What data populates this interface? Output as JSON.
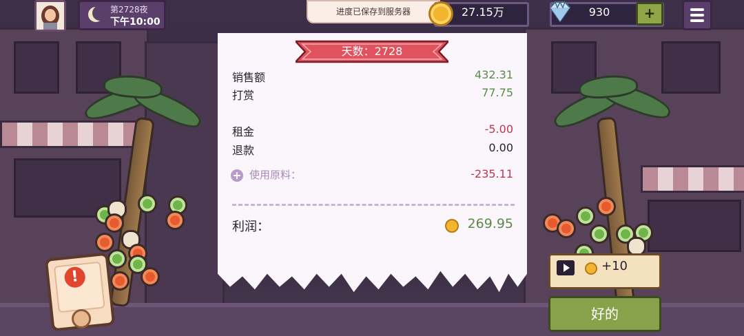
{
  "hud": {
    "night_label": "第2728夜",
    "time_label": "下午10:00",
    "toast": "进度已保存到服务器",
    "coins": "27.15万",
    "gems": "930",
    "add_label": "+"
  },
  "receipt": {
    "day_banner": "天数：2728",
    "rows": [
      {
        "label": "销售额",
        "value": "432.31"
      },
      {
        "label": "打赏",
        "value": "77.75"
      },
      {
        "label": "租金",
        "value": "-5.00"
      },
      {
        "label": "退款",
        "value": "0.00"
      }
    ],
    "materials_label": "使用原料：",
    "materials_value": "-235.11",
    "profit_label": "利润：",
    "profit_value": "269.95"
  },
  "actions": {
    "ad_reward": "+10",
    "ok_label": "好的"
  },
  "colors": {
    "positive": "#5b8a4a",
    "negative": "#c0364a",
    "banner": "#e0525e",
    "ok_button": "#87a24a"
  }
}
